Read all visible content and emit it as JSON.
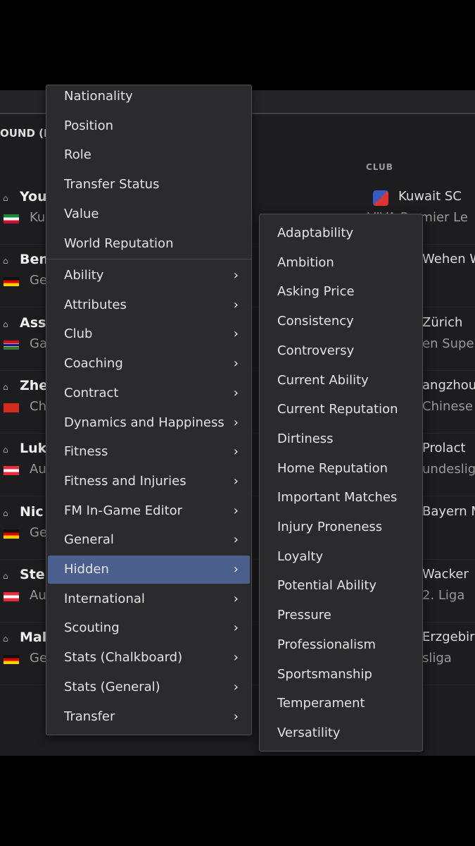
{
  "header": {
    "section_title": "OUND (F",
    "club_column": "CLUB"
  },
  "rows": [
    {
      "name": "You",
      "nation": "Ku",
      "flag": "kuwait",
      "club": "Kuwait SC",
      "league": "VIVA Premier Le"
    },
    {
      "name": "Ben",
      "nation": "Ge",
      "flag": "germany",
      "club": "Wehen W",
      "league": ""
    },
    {
      "name": "Ass",
      "nation": "Ga",
      "flag": "gambia",
      "club": "Zürich",
      "league": "en Super"
    },
    {
      "name": "Zhe",
      "nation": "Ch",
      "flag": "china",
      "club": "angzhou",
      "league": "Chinese"
    },
    {
      "name": "Luk",
      "nation": "Au",
      "flag": "austria",
      "club": "Prolact",
      "league": "undeslig"
    },
    {
      "name": "Nic",
      "nation": "Ge",
      "flag": "germany",
      "club": "Bayern M",
      "league": ""
    },
    {
      "name": "Ste",
      "nation": "Au",
      "flag": "austria",
      "club": "Wacker",
      "league": "2. Liga"
    },
    {
      "name": "Mal",
      "nation": "Ge",
      "flag": "germany",
      "club": "Erzgebir",
      "league": "sliga"
    }
  ],
  "main_menu": {
    "plain_items": [
      "Nationality",
      "Position",
      "Role",
      "Transfer Status",
      "Value",
      "World Reputation"
    ],
    "submenu_items": [
      "Ability",
      "Attributes",
      "Club",
      "Coaching",
      "Contract",
      "Dynamics and Happiness",
      "Fitness",
      "Fitness and Injuries",
      "FM In-Game Editor",
      "General",
      "Hidden",
      "International",
      "Scouting",
      "Stats (Chalkboard)",
      "Stats (General)",
      "Transfer"
    ],
    "highlighted": "Hidden",
    "chevron": "›"
  },
  "hidden_submenu": {
    "items": [
      "Adaptability",
      "Ambition",
      "Asking Price",
      "Consistency",
      "Controversy",
      "Current Ability",
      "Current Reputation",
      "Dirtiness",
      "Home Reputation",
      "Important Matches",
      "Injury Proneness",
      "Loyalty",
      "Potential Ability",
      "Pressure",
      "Professionalism",
      "Sportsmanship",
      "Temperament",
      "Versatility"
    ]
  },
  "colors": {
    "highlight": "#4a5f8c",
    "background": "#1d1d1f",
    "menu": "#2b2b2d"
  }
}
